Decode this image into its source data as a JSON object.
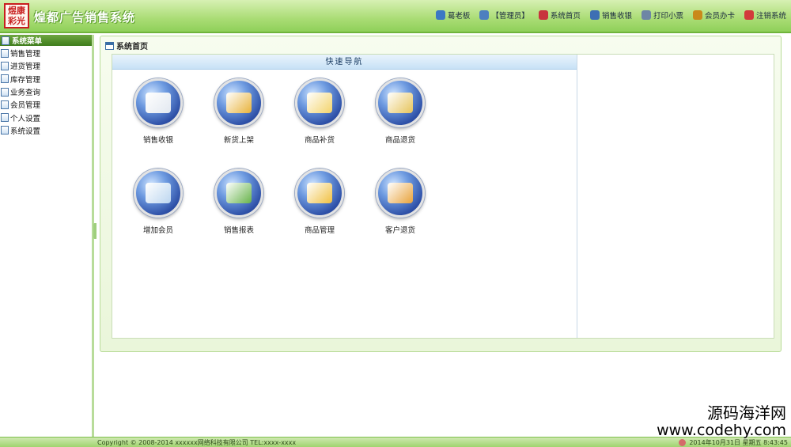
{
  "header": {
    "logo_text": "煜康彩光",
    "app_title": "煌都广告销售系统",
    "nav": [
      {
        "label": "葛老板",
        "icon": "user-icon",
        "color": "#3b78c4"
      },
      {
        "label": "【管理员】",
        "icon": "role-icon",
        "color": "#4d7fbf"
      },
      {
        "label": "系统首页",
        "icon": "home-icon",
        "color": "#c8333d"
      },
      {
        "label": "销售收银",
        "icon": "cashier-icon",
        "color": "#3d6fb3"
      },
      {
        "label": "打印小票",
        "icon": "printer-icon",
        "color": "#6e86a5"
      },
      {
        "label": "会员办卡",
        "icon": "member-card-icon",
        "color": "#c9891b"
      },
      {
        "label": "注销系统",
        "icon": "logout-icon",
        "color": "#d23b3b"
      }
    ]
  },
  "sidebar": {
    "title": "系统菜单",
    "items": [
      {
        "label": "销售管理"
      },
      {
        "label": "进货管理"
      },
      {
        "label": "库存管理"
      },
      {
        "label": "业务查询"
      },
      {
        "label": "会员管理"
      },
      {
        "label": "个人设置"
      },
      {
        "label": "系统设置"
      }
    ]
  },
  "main": {
    "panel_title": "系统首页",
    "nav_title": "快速导航",
    "tiles": [
      {
        "label": "销售收银",
        "icon": "cash-register-icon",
        "color": "#e2e8f0"
      },
      {
        "label": "新货上架",
        "icon": "new-goods-icon",
        "color": "#e8b23a"
      },
      {
        "label": "商品补货",
        "icon": "restock-icon",
        "color": "#f3d36a"
      },
      {
        "label": "商品退货",
        "icon": "return-goods-icon",
        "color": "#e6c35a"
      },
      {
        "label": "增加会员",
        "icon": "add-member-icon",
        "color": "#bcd6f0"
      },
      {
        "label": "销售报表",
        "icon": "sales-report-icon",
        "color": "#67b34a"
      },
      {
        "label": "商品管理",
        "icon": "goods-manage-icon",
        "color": "#f0c040"
      },
      {
        "label": "客户退货",
        "icon": "customer-return-icon",
        "color": "#e8a23a"
      }
    ]
  },
  "footer": {
    "copyright": "Copyright © 2008-2014 xxxxxx网络科技有限公司  TEL:xxxx-xxxx",
    "datetime": "2014年10月31日  星期五  8:43:45"
  },
  "watermark": {
    "cn": "源码海洋网",
    "url": "www.codehy.com"
  }
}
